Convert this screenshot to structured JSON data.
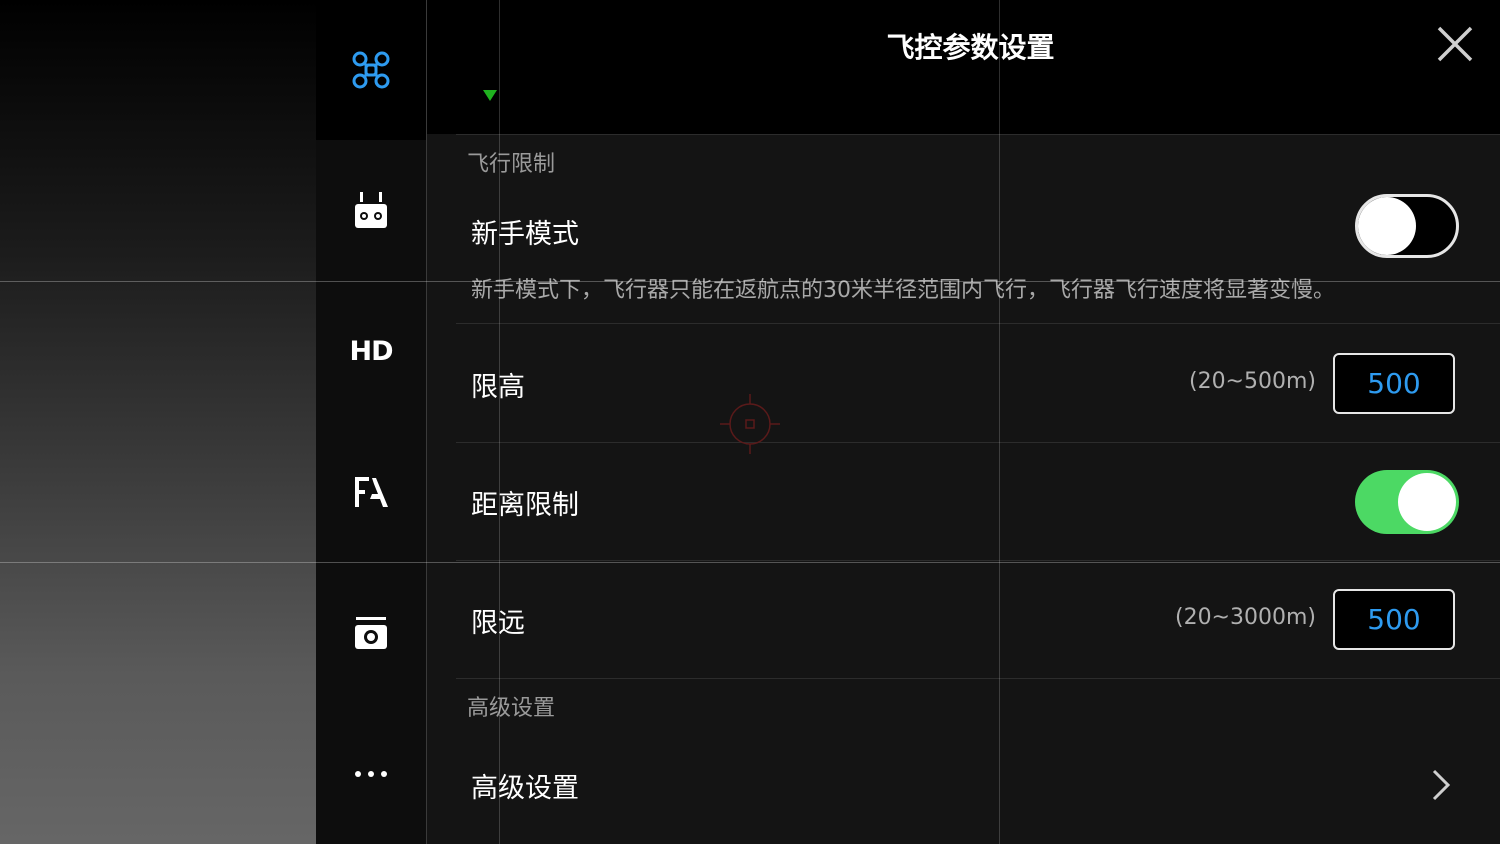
{
  "panel": {
    "title": "飞控参数设置"
  },
  "rail": {
    "items": [
      {
        "icon": "aircraft-icon"
      },
      {
        "icon": "remote-controller-icon"
      },
      {
        "icon": "hd-transmission-icon",
        "label": "HD"
      },
      {
        "icon": "battery-icon"
      },
      {
        "icon": "gimbal-camera-icon"
      },
      {
        "icon": "more-icon"
      }
    ]
  },
  "flight_limits": {
    "section_label": "飞行限制",
    "beginner_mode": {
      "label": "新手模式",
      "enabled": false,
      "description": "新手模式下，飞行器只能在返航点的30米半径范围内飞行，飞行器飞行速度将显著变慢。"
    },
    "height_limit": {
      "label": "限高",
      "range": "(20~500m)",
      "value": "500"
    },
    "distance_limit": {
      "label": "距离限制",
      "enabled": true
    },
    "max_distance": {
      "label": "限远",
      "range": "(20~3000m)",
      "value": "500"
    }
  },
  "advanced": {
    "section_label": "高级设置",
    "row_label": "高级设置"
  },
  "colors": {
    "accent_blue": "#2e9bf0",
    "toggle_on": "#4cd964",
    "indicator_green": "#1fb11f"
  }
}
